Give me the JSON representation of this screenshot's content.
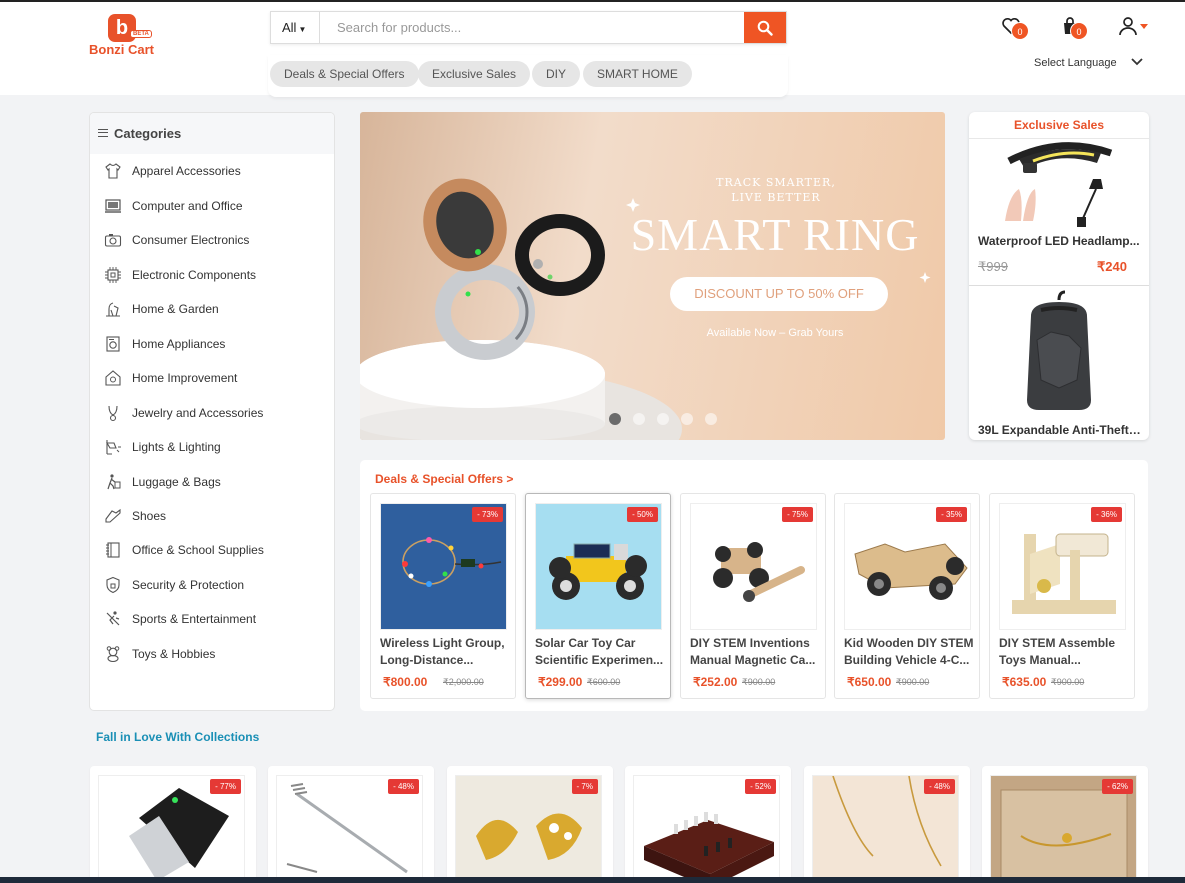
{
  "brand": {
    "name": "Bonzi Cart",
    "badge": "BETA",
    "logo_letter": "b",
    "accent_color": "#ef5524"
  },
  "search": {
    "category": "All",
    "placeholder": "Search for products...",
    "icon": "search-icon"
  },
  "quick_links": [
    "Deals & Special Offers",
    "Exclusive Sales",
    "DIY",
    "SMART HOME"
  ],
  "header": {
    "wishlist_count": "0",
    "cart_count": "0",
    "language_label": "Select Language"
  },
  "sidebar": {
    "title": "Categories",
    "items": [
      {
        "label": "Apparel Accessories",
        "icon": "shirt-icon"
      },
      {
        "label": "Computer and Office",
        "icon": "computer-icon"
      },
      {
        "label": "Consumer Electronics",
        "icon": "camera-icon"
      },
      {
        "label": "Electronic Components",
        "icon": "chip-icon"
      },
      {
        "label": "Home & Garden",
        "icon": "garden-icon"
      },
      {
        "label": "Home Appliances",
        "icon": "appliance-icon"
      },
      {
        "label": "Home Improvement",
        "icon": "house-icon"
      },
      {
        "label": "Jewelry and Accessories",
        "icon": "necklace-icon"
      },
      {
        "label": "Lights & Lighting",
        "icon": "lamp-icon"
      },
      {
        "label": "Luggage & Bags",
        "icon": "luggage-icon"
      },
      {
        "label": "Shoes",
        "icon": "shoe-icon"
      },
      {
        "label": "Office & School Supplies",
        "icon": "notebook-icon"
      },
      {
        "label": "Security & Protection",
        "icon": "shield-icon"
      },
      {
        "label": "Sports & Entertainment",
        "icon": "sports-icon"
      },
      {
        "label": "Toys & Hobbies",
        "icon": "teddy-bear-icon"
      }
    ]
  },
  "banner": {
    "eyebrow": "TRACK SMARTER, LIVE BETTER",
    "title": "SMART RING",
    "cta": "DISCOUNT UP TO 50% OFF",
    "subtitle": "Available Now – Grab Yours",
    "slide_count": 5,
    "active_slide": 1
  },
  "exclusive": {
    "title": "Exclusive Sales",
    "items": [
      {
        "name": "Waterproof LED Headlamp...",
        "old_price": "₹999",
        "price": "₹240"
      },
      {
        "name": "39L Expandable Anti-Theft ..."
      }
    ]
  },
  "deals": {
    "title": "Deals & Special Offers",
    "arrow": ">",
    "products": [
      {
        "name1": "Wireless Light Group,",
        "name2": "Long-Distance...",
        "price": "₹800.00",
        "old_price": "₹2,000.00",
        "discount": "- 73%"
      },
      {
        "name1": "Solar Car Toy Car",
        "name2": "Scientific Experimen...",
        "price": "₹299.00",
        "old_price": "₹600.00",
        "discount": "- 50%"
      },
      {
        "name1": "DIY STEM Inventions",
        "name2": "Manual Magnetic Ca...",
        "price": "₹252.00",
        "old_price": "₹900.00",
        "discount": "- 75%"
      },
      {
        "name1": "Kid Wooden DIY STEM",
        "name2": "Building Vehicle 4-C...",
        "price": "₹650.00",
        "old_price": "₹900.00",
        "discount": "- 35%"
      },
      {
        "name1": "DIY STEM Assemble",
        "name2": "Toys Manual...",
        "price": "₹635.00",
        "old_price": "₹900.00",
        "discount": "- 36%"
      }
    ]
  },
  "collections": {
    "title": "Fall in Love With Collections",
    "items": [
      {
        "discount": "- 77%"
      },
      {
        "discount": "- 48%"
      },
      {
        "discount": "- 7%"
      },
      {
        "discount": "- 52%"
      },
      {
        "discount": "- 48%"
      },
      {
        "discount": "- 62%"
      }
    ]
  }
}
